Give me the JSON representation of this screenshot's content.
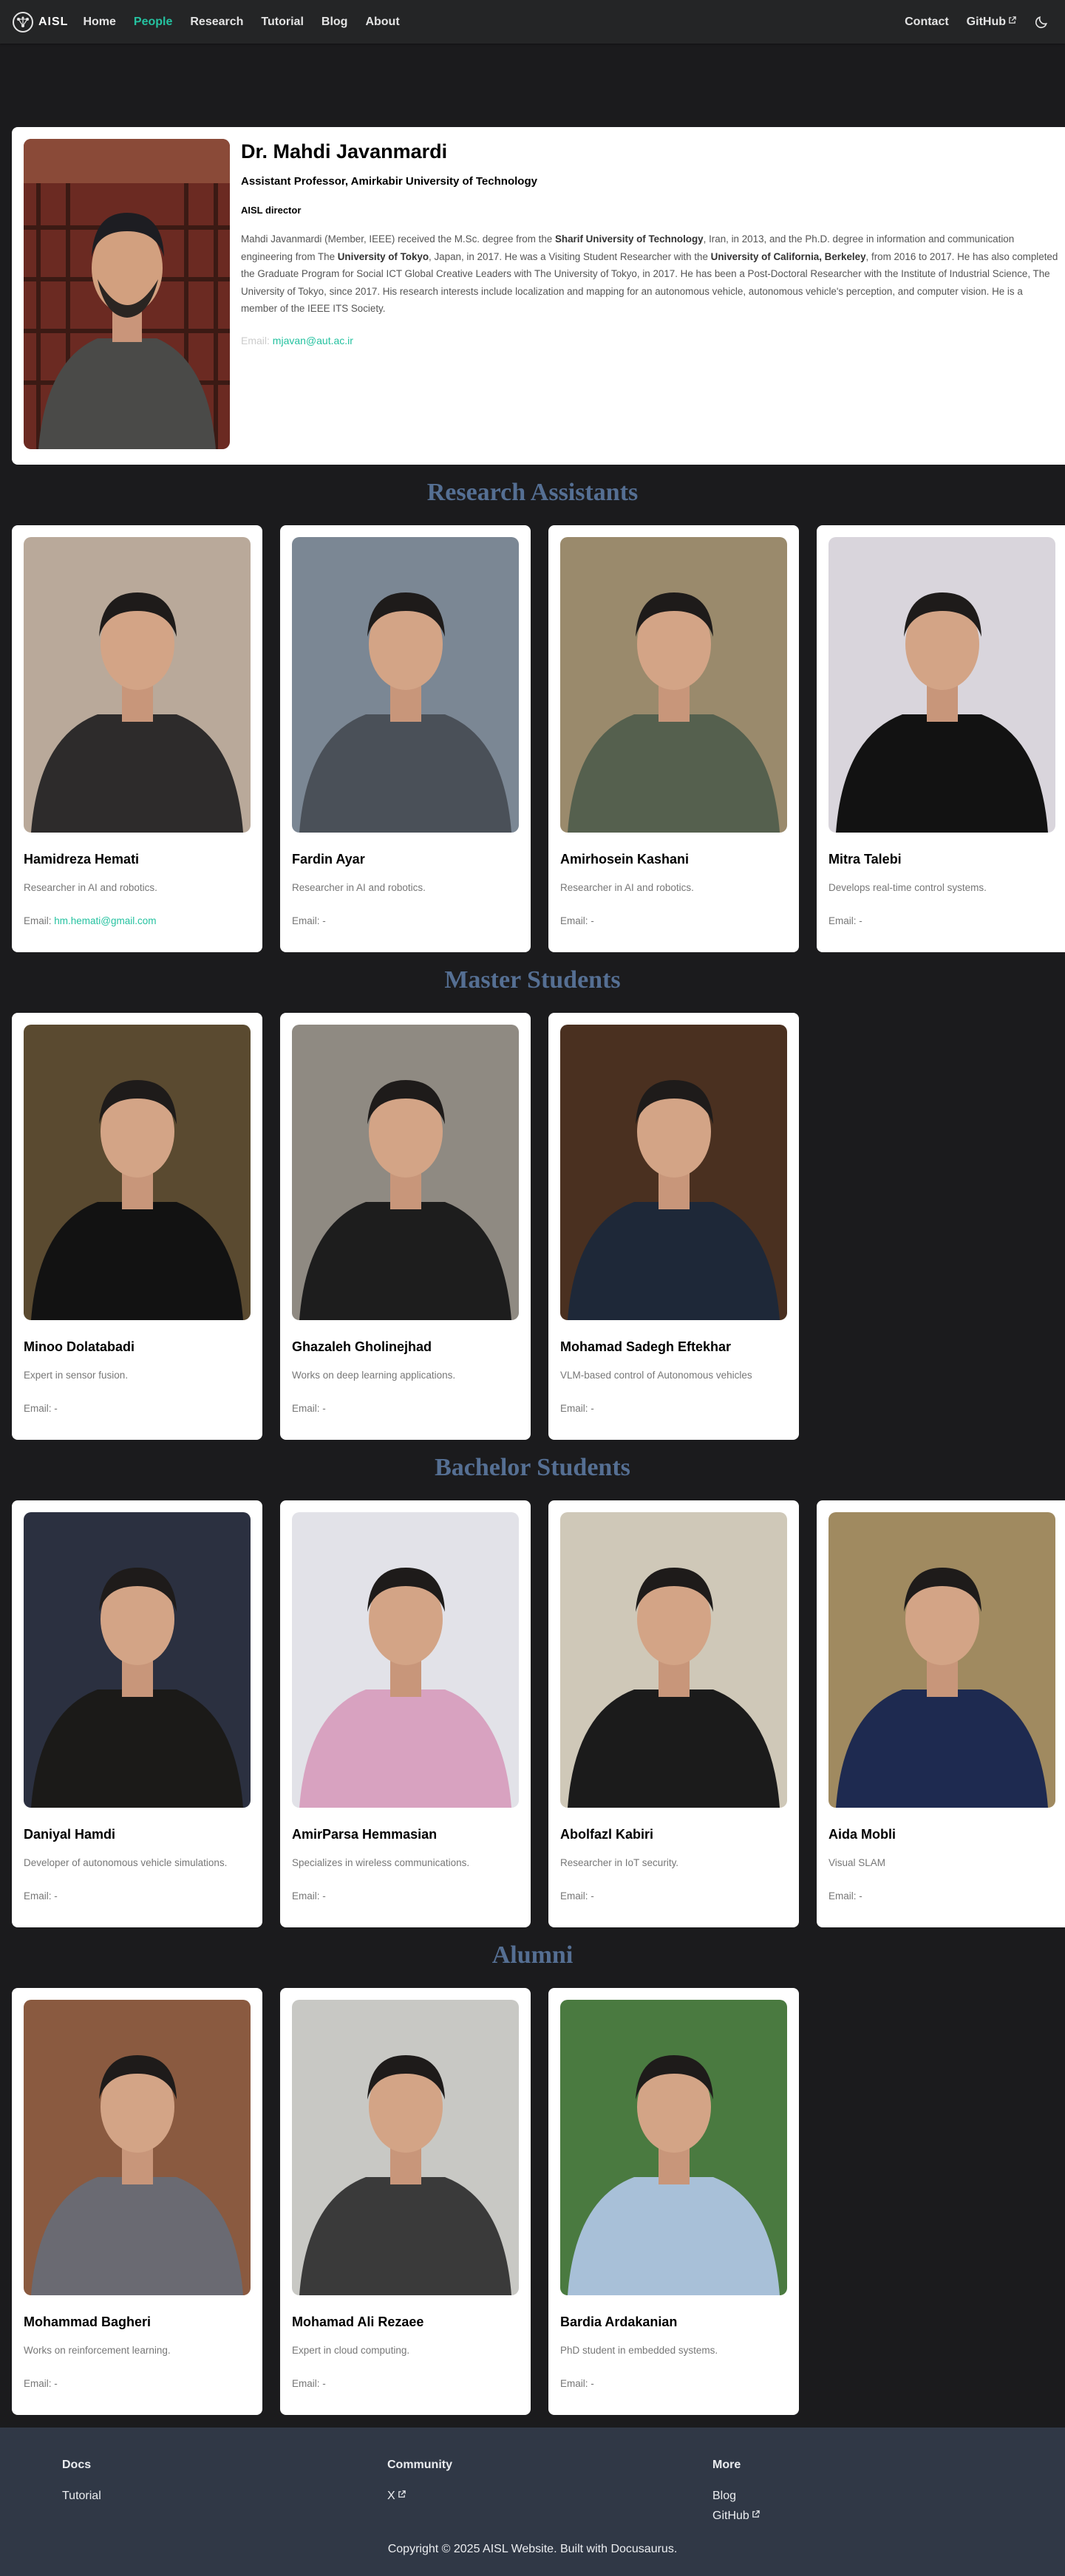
{
  "navbar": {
    "logo_icon": "network-logo-icon",
    "logo_text": "AISL",
    "links": [
      {
        "label": "Home"
      },
      {
        "label": "People"
      },
      {
        "label": "Research"
      },
      {
        "label": "Tutorial"
      },
      {
        "label": "Blog"
      },
      {
        "label": "About"
      }
    ],
    "right_links": [
      {
        "label": "Contact"
      },
      {
        "label": "GitHub"
      }
    ],
    "theme_icon": "moon-icon",
    "accent_color": "#25c2a0"
  },
  "professor": {
    "name": "Dr. Mahdi Javanmardi",
    "title": "Assistant Professor, Amirkabir University of Technology",
    "role": "AISL director",
    "bio_parts": [
      "Mahdi Javanmardi (Member, IEEE) received the M.Sc. degree from the ",
      "Sharif University of Technology",
      ", Iran, in 2013, and the Ph.D. degree in information and communication engineering from The ",
      "University of Tokyo",
      ", Japan, in 2017. He was a Visiting Student Researcher with the ",
      "University of California, Berkeley",
      ", from 2016 to 2017. He has also completed the Graduate Program for Social ICT Global Creative Leaders with The University of Tokyo, in 2017. He has been a Post-Doctoral Researcher with the Institute of Industrial Science, The University of Tokyo, since 2017. His research interests include localization and mapping for an autonomous vehicle, autonomous vehicle's perception, and computer vision. He is a member of the IEEE ITS Society."
    ],
    "email_label": "Email:",
    "email": "mjavan@aut.ac.ir"
  },
  "sections": {
    "research_assistants": "Research Assistants",
    "master_students": "Master Students",
    "bachelor_students": "Bachelor Students",
    "alumni": "Alumni"
  },
  "research_assistants": [
    {
      "name": "Hamidreza Hemati",
      "desc": "Researcher in AI and robotics.",
      "email_label": "Email:",
      "email": "hm.hemati@gmail.com"
    },
    {
      "name": "Fardin Ayar",
      "desc": "Researcher in AI and robotics.",
      "email_label": "Email:",
      "email": "-"
    },
    {
      "name": "Amirhosein Kashani",
      "desc": "Researcher in AI and robotics.",
      "email_label": "Email:",
      "email": "-"
    },
    {
      "name": "Mitra Talebi",
      "desc": "Develops real-time control systems.",
      "email_label": "Email:",
      "email": "-"
    }
  ],
  "master_students": [
    {
      "name": "Minoo Dolatabadi",
      "desc": "Expert in sensor fusion.",
      "email_label": "Email:",
      "email": "-"
    },
    {
      "name": "Ghazaleh Gholinejhad",
      "desc": "Works on deep learning applications.",
      "email_label": "Email:",
      "email": "-"
    },
    {
      "name": "Mohamad Sadegh Eftekhar",
      "desc": "VLM-based control of Autonomous vehicles",
      "email_label": "Email:",
      "email": "-"
    }
  ],
  "bachelor_students": [
    {
      "name": "Daniyal Hamdi",
      "desc": "Developer of autonomous vehicle simulations.",
      "email_label": "Email:",
      "email": "-"
    },
    {
      "name": "AmirParsa Hemmasian",
      "desc": "Specializes in wireless communications.",
      "email_label": "Email:",
      "email": "-"
    },
    {
      "name": "Abolfazl Kabiri",
      "desc": "Researcher in IoT security.",
      "email_label": "Email:",
      "email": "-"
    },
    {
      "name": "Aida Mobli",
      "desc": "Visual SLAM",
      "email_label": "Email:",
      "email": "-"
    }
  ],
  "alumni": [
    {
      "name": "Mohammad Bagheri",
      "desc": "Works on reinforcement learning.",
      "email_label": "Email:",
      "email": "-"
    },
    {
      "name": "Mohamad Ali Rezaee",
      "desc": "Expert in cloud computing.",
      "email_label": "Email:",
      "email": "-"
    },
    {
      "name": "Bardia Ardakanian",
      "desc": "PhD student in embedded systems.",
      "email_label": "Email:",
      "email": "-"
    }
  ],
  "footer": {
    "columns": [
      {
        "title": "Docs",
        "links": [
          {
            "label": "Tutorial"
          }
        ]
      },
      {
        "title": "Community",
        "links": [
          {
            "label": "X"
          }
        ]
      },
      {
        "title": "More",
        "links": [
          {
            "label": "Blog"
          },
          {
            "label": "GitHub"
          }
        ]
      }
    ],
    "copyright": "Copyright © 2025 AISL Website. Built with Docusaurus."
  }
}
